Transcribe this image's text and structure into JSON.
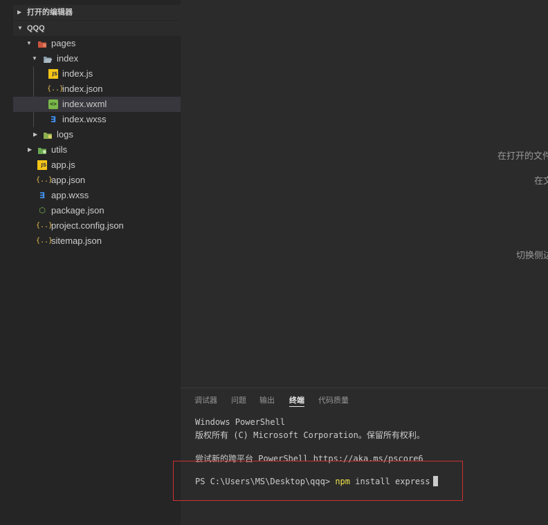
{
  "explorer": {
    "open_editors_label": "打开的编辑器",
    "project_label": "QQQ",
    "tree": [
      {
        "name": "pages",
        "kind": "folder-pages",
        "expanded": true
      },
      {
        "name": "index",
        "kind": "folder",
        "expanded": true
      },
      {
        "name": "index.js",
        "kind": "js"
      },
      {
        "name": "index.json",
        "kind": "json"
      },
      {
        "name": "index.wxml",
        "kind": "wxml",
        "selected": true
      },
      {
        "name": "index.wxss",
        "kind": "wxss"
      },
      {
        "name": "logs",
        "kind": "folder",
        "expanded": false
      },
      {
        "name": "utils",
        "kind": "folder",
        "expanded": false
      },
      {
        "name": "app.js",
        "kind": "js"
      },
      {
        "name": "app.json",
        "kind": "json"
      },
      {
        "name": "app.wxss",
        "kind": "wxss"
      },
      {
        "name": "package.json",
        "kind": "package"
      },
      {
        "name": "project.config.json",
        "kind": "json"
      },
      {
        "name": "sitemap.json",
        "kind": "json"
      }
    ]
  },
  "editor": {
    "hints": [
      "在打开的文件",
      "在文",
      "切换侧边"
    ]
  },
  "panel": {
    "tabs": [
      "调试器",
      "问题",
      "输出",
      "终端",
      "代码质量"
    ],
    "active_tab": "终端",
    "terminal": {
      "line1": "Windows PowerShell",
      "line2": "版权所有 (C) Microsoft Corporation。保留所有权利。",
      "line3": "尝试新的跨平台 PowerShell https://aka.ms/pscore6",
      "prompt": "PS C:\\Users\\MS\\Desktop\\qqq>",
      "command_name": "npm",
      "command_args": "install express"
    }
  },
  "colors": {
    "highlight": "#d03030",
    "npm_keyword": "#f0e24a",
    "js_icon": "#f5c518",
    "json_icon": "#e9c14a",
    "wxml_icon": "#7ab84a",
    "wxss_icon": "#3f8ee8"
  }
}
